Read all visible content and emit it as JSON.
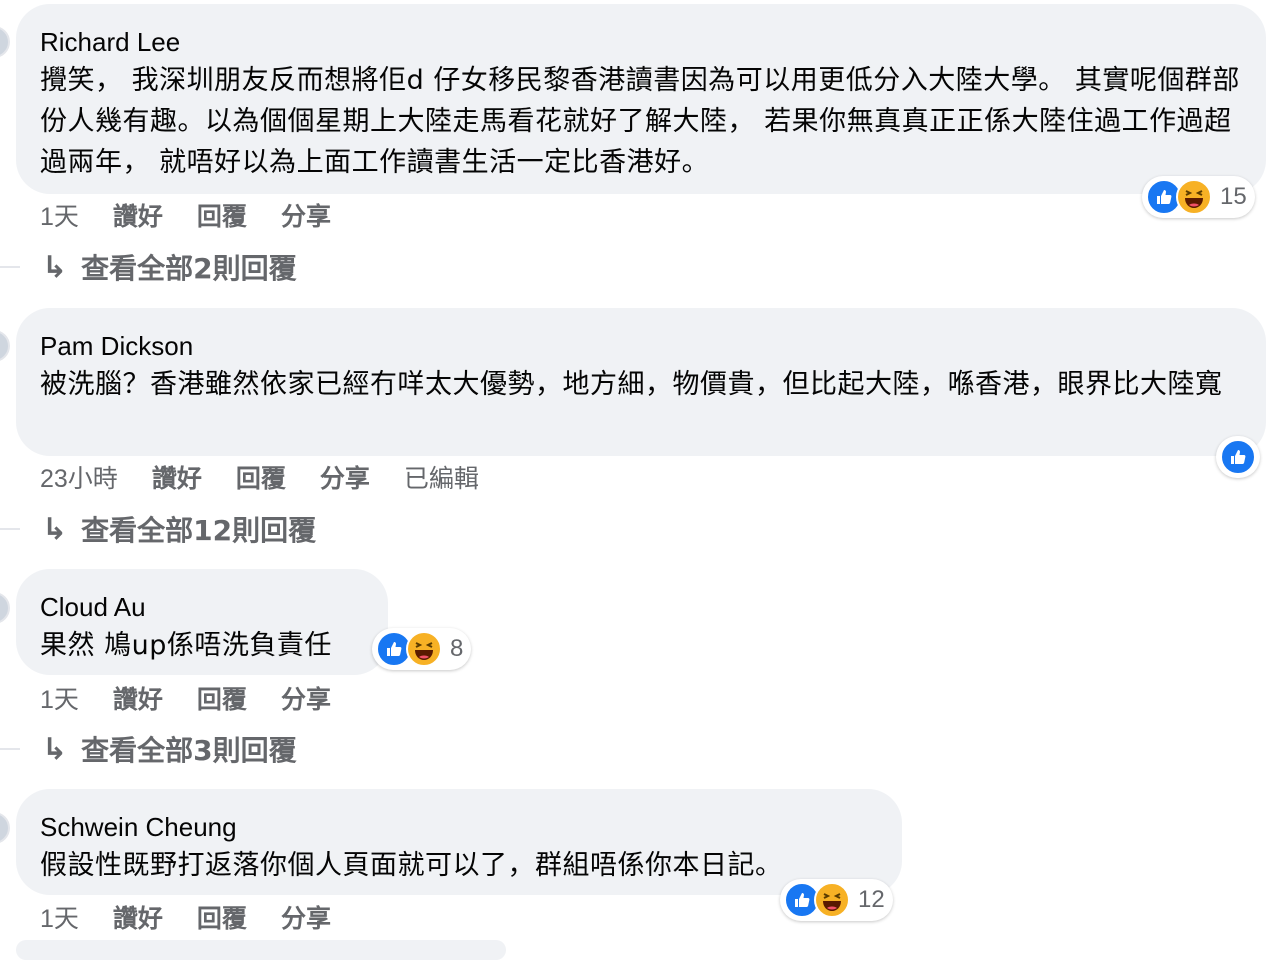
{
  "comments": [
    {
      "author": "Richard Lee",
      "text": "攪笑， 我深圳朋友反而想將佢d 仔女移民黎香港讀書因為可以用更低分入大陸大學。 其實呢個群部份人幾有趣。以為個個星期上大陸走馬看花就好了解大陸， 若果你無真真正正係大陸住過工作過超過兩年， 就唔好以為上面工作讀書生活一定比香港好。",
      "time": "1天",
      "like_label": "讚好",
      "reply_label": "回覆",
      "share_label": "分享",
      "reaction_count": "15",
      "view_replies": "查看全部2則回覆"
    },
    {
      "author": "Pam Dickson",
      "text": "被洗腦？香港雖然依家已經冇咩太大優勢，地方細，物價貴，但比起大陸，喺香港，眼界比大陸寬",
      "time": "23小時",
      "like_label": "讚好",
      "reply_label": "回覆",
      "share_label": "分享",
      "edited_label": "已編輯",
      "view_replies": "查看全部12則回覆"
    },
    {
      "author": "Cloud Au",
      "text": "果然 鳩up係唔洗負責任",
      "time": "1天",
      "like_label": "讚好",
      "reply_label": "回覆",
      "share_label": "分享",
      "reaction_count": "8",
      "view_replies": "查看全部3則回覆"
    },
    {
      "author": "Schwein Cheung",
      "text": "假設性既野打返落你個人頁面就可以了，群組唔係你本日記。",
      "time": "1天",
      "like_label": "讚好",
      "reply_label": "回覆",
      "share_label": "分享",
      "reaction_count": "12"
    }
  ],
  "icons": {
    "reply_arrow": "reply-arrow-icon",
    "like": "like-icon",
    "haha": "haha-icon"
  },
  "colors": {
    "like_blue": "#1877f2",
    "haha_yellow": "#f7b125",
    "bubble_bg": "#f0f2f5",
    "secondary_text": "#65676b"
  }
}
